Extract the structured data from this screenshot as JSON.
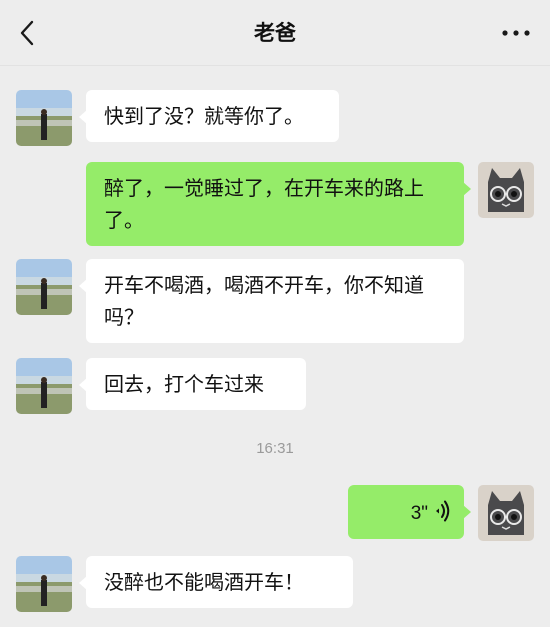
{
  "header": {
    "title": "老爸",
    "back_icon": "chevron-left-icon",
    "more_icon": "more-dots-icon"
  },
  "colors": {
    "background": "#ededed",
    "bubble_self": "#95ec69",
    "bubble_other": "#ffffff",
    "timestamp": "#9a9a9a"
  },
  "messages": [
    {
      "sender": "dad",
      "text": "快到了没？就等你了。"
    },
    {
      "sender": "me",
      "text": "醉了，一觉睡过了，在开车来的路上了。"
    },
    {
      "sender": "dad",
      "text": "开车不喝酒，喝酒不开车，你不知道吗？"
    },
    {
      "sender": "dad",
      "text": "回去，打个车过来"
    },
    {
      "timestamp": "16:31"
    },
    {
      "sender": "me",
      "type": "voice",
      "duration": "3\""
    },
    {
      "sender": "dad",
      "text": "没醉也不能喝酒开车！"
    }
  ]
}
